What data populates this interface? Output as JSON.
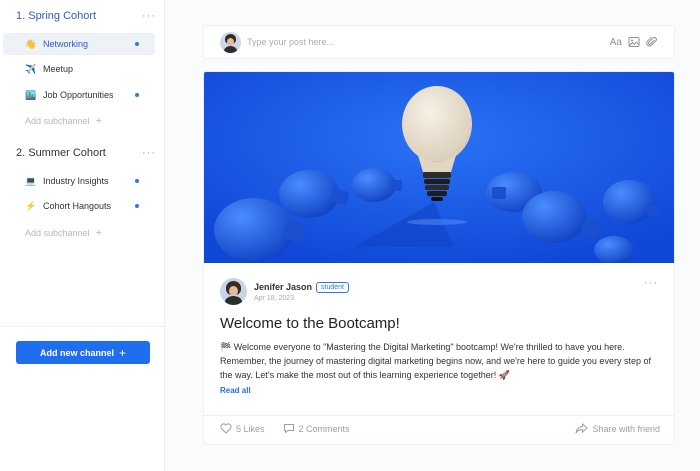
{
  "sidebar": {
    "cohorts": [
      {
        "title": "1. Spring Cohort",
        "menu": "···",
        "channels": [
          {
            "emoji": "👋",
            "label": "Networking",
            "active": true,
            "unread": true
          },
          {
            "emoji": "✈️",
            "label": "Meetup",
            "active": false,
            "unread": false
          },
          {
            "emoji": "🏙️",
            "label": "Job Opportunities",
            "active": false,
            "unread": true
          }
        ],
        "add_subchannel": "Add subchannel"
      },
      {
        "title": "2. Summer Cohort",
        "menu": "···",
        "channels": [
          {
            "emoji": "💻",
            "label": "Industry Insights",
            "active": false,
            "unread": true
          },
          {
            "emoji": "⚡",
            "label": "Cohort Hangouts",
            "active": false,
            "unread": true
          }
        ],
        "add_subchannel": "Add subchannel"
      }
    ],
    "add_channel_label": "Add new channel"
  },
  "composer": {
    "placeholder": "Type your post here...",
    "format_icon_label": "Aa"
  },
  "post": {
    "author": "Jenifer Jason",
    "badge": "student",
    "date": "Apr 18, 2023",
    "menu": "···",
    "title": "Welcome to the Bootcamp!",
    "body": "🏁 Welcome everyone to \"Mastering the Digital Marketing\" bootcamp! We're thrilled to have you here. Remember, the journey of mastering digital marketing begins now, and we're here to guide you every step of the way. Let's make the most out of this learning experience together! 🚀",
    "read_all": "Read all",
    "likes": "5 Likes",
    "comments": "2 Comments",
    "share": "Share with friend"
  },
  "colors": {
    "accent": "#1f6ef0",
    "hero_bg": "#1a5ae6"
  }
}
